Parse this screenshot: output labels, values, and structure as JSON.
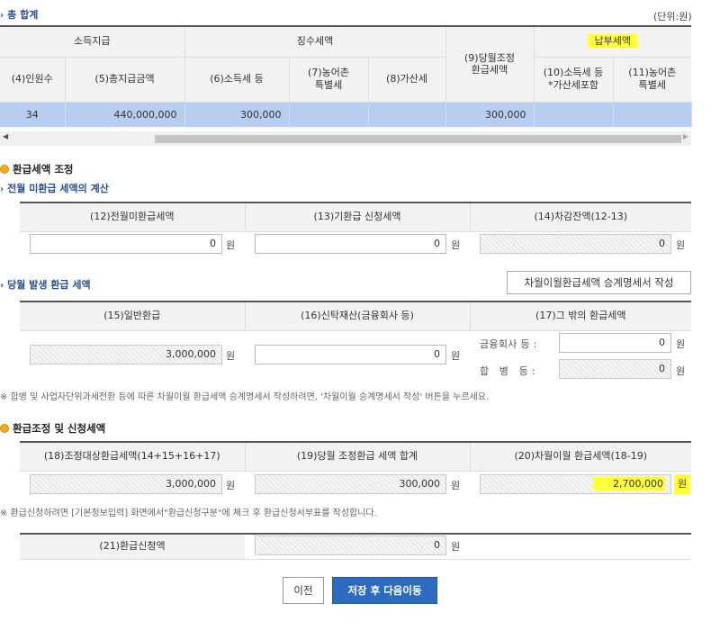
{
  "summary": {
    "title": "총 합계",
    "unit": "(단위:원)",
    "groups": {
      "income": "소득지급",
      "withheld": "징수세액",
      "refund": "(9)당월조정\n환급세액",
      "payable": "납부세액"
    },
    "columns": {
      "c4": "(4)인원수",
      "c5": "(5)총지급금액",
      "c6": "(6)소득세 등",
      "c7": "(7)농어촌\n특별세",
      "c8": "(8)가산세",
      "c10": "(10)소득세 등\n*가산세포함",
      "c11": "(11)농어촌\n특별세"
    },
    "row": {
      "c4": "34",
      "c5": "440,000,000",
      "c6": "300,000",
      "c7": "",
      "c8": "",
      "c9": "300,000",
      "c10": "",
      "c11": ""
    },
    "scrollbar": {
      "left_arrow": "◀",
      "right_arrow": "▶"
    }
  },
  "refund_adjust": {
    "title": "환급세액 조정",
    "prev": {
      "title": "전월 미환급 세액의 계산",
      "h12": "(12)전월미환급세액",
      "h13": "(13)기환급 신청세액",
      "h14": "(14)차감잔액(12-13)",
      "v12": "0",
      "v13": "0",
      "v14": "0"
    },
    "current": {
      "title": "당월 발생 환급 세액",
      "button": "차월이월환급세액 승계명세서 작성",
      "h15": "(15)일반환급",
      "h16": "(16)신탁재산(금융회사 등)",
      "h17": "(17)그 밖의 환급세액",
      "v15": "3,000,000",
      "v16": "0",
      "fin_label": "금융회사 등 :",
      "fin_value": "0",
      "merge_label": "합   병   등 :",
      "merge_value": "0"
    },
    "note": "※ 합병 및 사업자단위과세전환 등에 따른 차월이월 환급세액 승계명세서 작성하려면, '차월이월 승계명세서 작성' 버튼을 누르세요."
  },
  "apply": {
    "title": "환급조정 및 신청세액",
    "h18": "(18)조정대상환급세액(14+15+16+17)",
    "h19": "(19)당월 조정환급 세액 합계",
    "h20": "(20)차월이월 환급세액(18-19)",
    "v18": "3,000,000",
    "v19": "300,000",
    "v20": "2,700,000",
    "note": "※ 환급신청하려면 [기본정보입력] 화면에서\"환급신청구분\"에 체크 후 환급신청서부표를 작성합니다.",
    "h21": "(21)환급신청액",
    "v21": "0"
  },
  "won": "원",
  "buttons": {
    "prev": "이전",
    "save_next": "저장 후 다음이동"
  },
  "colors": {
    "highlight": "#ffff3a",
    "row_selected": "#b8cef0",
    "primary": "#2d6bbf",
    "title_blue": "#2a4f8f"
  }
}
